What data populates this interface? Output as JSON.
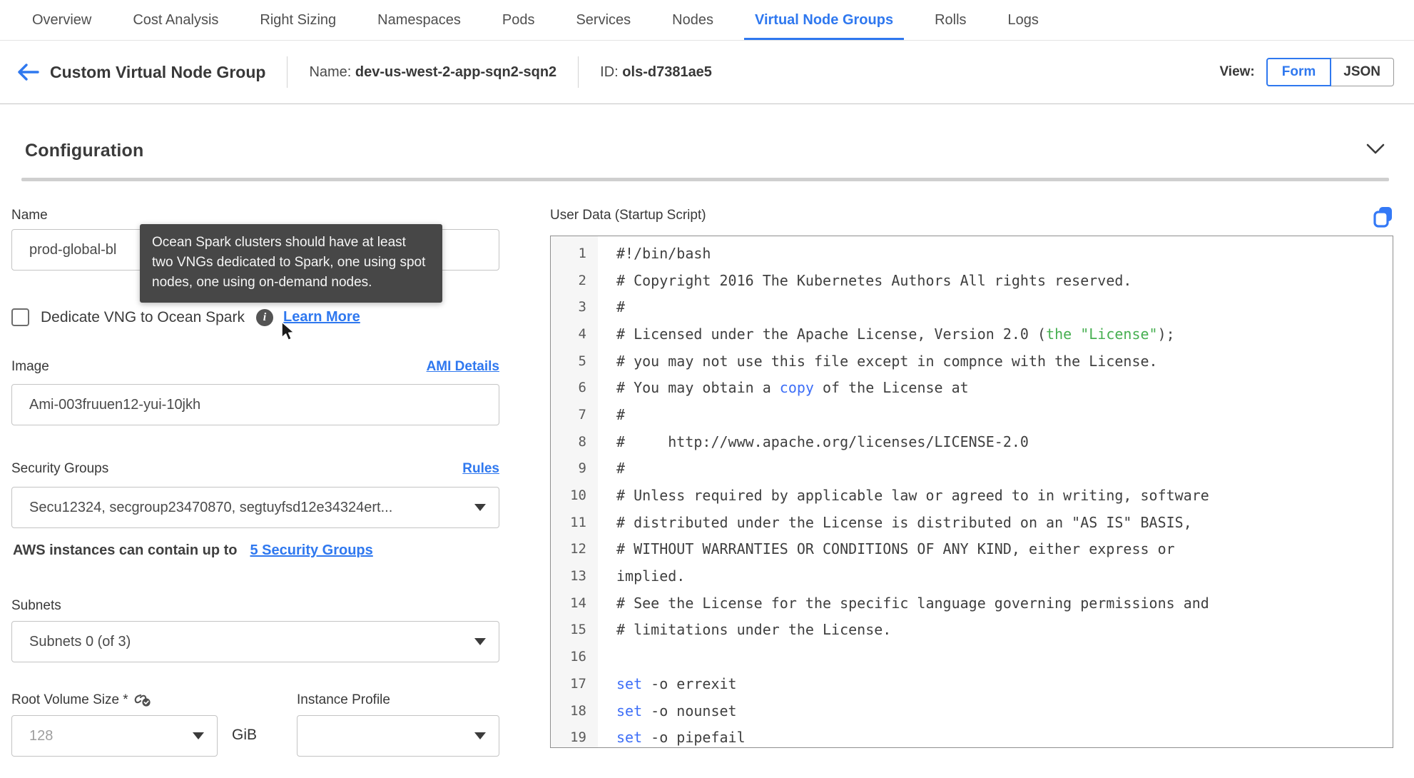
{
  "colors": {
    "accent_blue": "#2f78ef",
    "code_green": "#46af50",
    "code_blue": "#3d6ef7",
    "tooltip_bg": "#474747"
  },
  "tabs": {
    "items": [
      {
        "label": "Overview",
        "active": false
      },
      {
        "label": "Cost Analysis",
        "active": false
      },
      {
        "label": "Right Sizing",
        "active": false
      },
      {
        "label": "Namespaces",
        "active": false
      },
      {
        "label": "Pods",
        "active": false
      },
      {
        "label": "Services",
        "active": false
      },
      {
        "label": "Nodes",
        "active": false
      },
      {
        "label": "Virtual Node Groups",
        "active": true
      },
      {
        "label": "Rolls",
        "active": false
      },
      {
        "label": "Logs",
        "active": false
      }
    ]
  },
  "header": {
    "title": "Custom Virtual Node Group",
    "name_label": "Name:",
    "name_value": "dev-us-west-2-app-sqn2-sqn2",
    "id_label": "ID:",
    "id_value": "ols-d7381ae5",
    "view_label": "View:",
    "form_button": "Form",
    "json_button": "JSON"
  },
  "configuration": {
    "title": "Configuration"
  },
  "form": {
    "name": {
      "label": "Name",
      "value": "prod-global-bl"
    },
    "tooltip_text": "Ocean Spark clusters should have at least two VNGs dedicated to Spark, one using spot nodes, one using on-demand nodes.",
    "dedicate": {
      "label": "Dedicate VNG to Ocean Spark",
      "info_glyph": "i",
      "learn_more": "Learn More",
      "checked": false
    },
    "image": {
      "label": "Image",
      "link": "AMI Details",
      "value": "Ami-003fruuen12-yui-10jkh"
    },
    "security_groups": {
      "label": "Security Groups",
      "link": "Rules",
      "value": "Secu12324, secgroup23470870, segtuyfsd12e34324ert...",
      "note_text": "AWS instances can contain up to",
      "note_link": "5 Security Groups"
    },
    "subnets": {
      "label": "Subnets",
      "value": "Subnets 0 (of 3)"
    },
    "root_volume": {
      "label": "Root Volume Size * ",
      "placeholder": "128",
      "unit": "GiB"
    },
    "instance_profile": {
      "label": "Instance Profile",
      "value": ""
    }
  },
  "user_data": {
    "label": "User Data (Startup Script)",
    "lines": [
      {
        "n": "1",
        "segments": [
          {
            "t": "#!/bin/bash"
          }
        ]
      },
      {
        "n": "2",
        "segments": [
          {
            "t": "# Copyright 2016 The Kubernetes Authors All rights reserved."
          }
        ]
      },
      {
        "n": "3",
        "segments": [
          {
            "t": "#"
          }
        ]
      },
      {
        "n": "4",
        "segments": [
          {
            "t": "# Licensed under the Apache License, Version 2.0 ("
          },
          {
            "t": "the \"License\"",
            "c": "green"
          },
          {
            "t": ");"
          }
        ]
      },
      {
        "n": "5",
        "segments": [
          {
            "t": "# you may not use this file except in compnce with the License."
          }
        ]
      },
      {
        "n": "6",
        "segments": [
          {
            "t": "# You may obtain a "
          },
          {
            "t": "copy",
            "c": "blue"
          },
          {
            "t": " of the License at"
          }
        ]
      },
      {
        "n": "7",
        "segments": [
          {
            "t": "#"
          }
        ]
      },
      {
        "n": "8",
        "segments": [
          {
            "t": "#     http://www.apache.org/licenses/LICENSE-2.0"
          }
        ]
      },
      {
        "n": "9",
        "segments": [
          {
            "t": "#"
          }
        ]
      },
      {
        "n": "10",
        "segments": [
          {
            "t": "# Unless required by applicable law or agreed to in writing, software"
          }
        ]
      },
      {
        "n": "11",
        "segments": [
          {
            "t": "# distributed under the License is distributed on an \"AS IS\" BASIS,"
          }
        ]
      },
      {
        "n": "12",
        "segments": [
          {
            "t": "# WITHOUT WARRANTIES OR CONDITIONS OF ANY KIND, either express or"
          }
        ]
      },
      {
        "n": "13",
        "segments": [
          {
            "t": "implied."
          }
        ]
      },
      {
        "n": "14",
        "segments": [
          {
            "t": "# See the License for the specific language governing permissions and"
          }
        ]
      },
      {
        "n": "15",
        "segments": [
          {
            "t": "# limitations under the License."
          }
        ]
      },
      {
        "n": "16",
        "segments": []
      },
      {
        "n": "17",
        "segments": [
          {
            "t": "set",
            "c": "blue"
          },
          {
            "t": " -o errexit"
          }
        ]
      },
      {
        "n": "18",
        "segments": [
          {
            "t": "set",
            "c": "blue"
          },
          {
            "t": " -o nounset"
          }
        ]
      },
      {
        "n": "19",
        "segments": [
          {
            "t": "set",
            "c": "blue"
          },
          {
            "t": " -o pipefail"
          }
        ]
      }
    ]
  }
}
